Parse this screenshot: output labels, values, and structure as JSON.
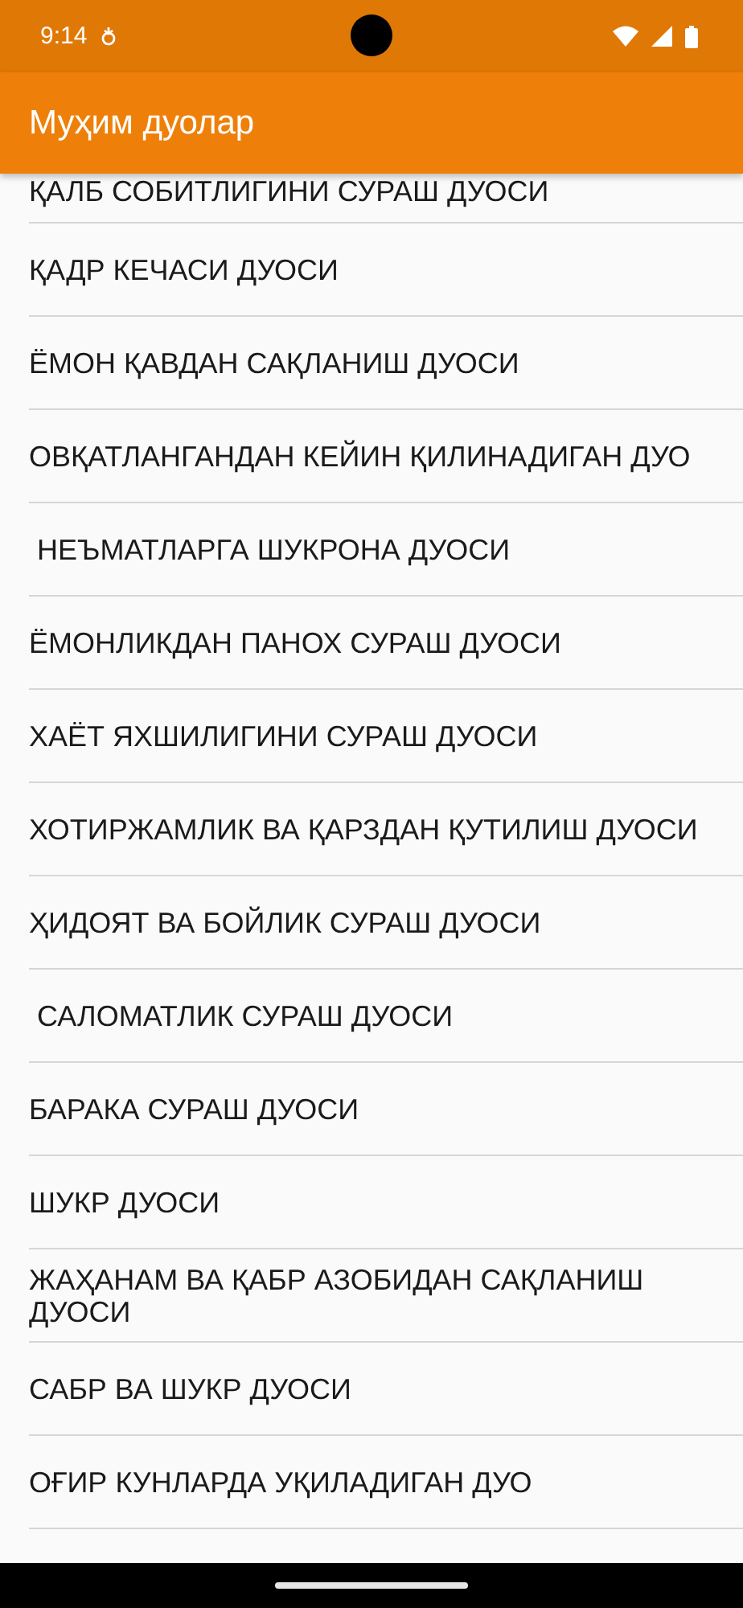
{
  "status_bar": {
    "time": "9:14"
  },
  "app_bar": {
    "title": "Муҳим дуолар"
  },
  "items": [
    {
      "label": "ҚАЛБ СОБИТЛИГИНИ СУРАШ ДУОСИ",
      "partial": true
    },
    {
      "label": "ҚАДР КЕЧАСИ ДУОСИ"
    },
    {
      "label": "ЁМОН ҚАВДАН САҚЛАНИШ ДУОСИ"
    },
    {
      "label": "ОВҚАТЛАНГАНДАН КЕЙИН ҚИЛИНАДИГАН ДУО"
    },
    {
      "label": " НЕЪМАТЛАРГА ШУКРОНА ДУОСИ"
    },
    {
      "label": "ЁМОНЛИКДАН ПАНОХ СУРАШ ДУОСИ"
    },
    {
      "label": "ХАЁТ ЯХШИЛИГИНИ СУРАШ ДУОСИ"
    },
    {
      "label": "ХОТИРЖАМЛИК ВА ҚАРЗДАН ҚУТИЛИШ ДУОСИ"
    },
    {
      "label": "ҲИДОЯТ ВА БОЙЛИК СУРАШ ДУОСИ"
    },
    {
      "label": " САЛОМАТЛИК СУРАШ ДУОСИ"
    },
    {
      "label": "БАРАКА СУРАШ ДУОСИ"
    },
    {
      "label": "ШУКР ДУОСИ"
    },
    {
      "label": "ЖАҲАНАМ ВА ҚАБР АЗОБИДАН САҚЛАНИШ ДУОСИ"
    },
    {
      "label": "САБР ВА ШУКР ДУОСИ"
    },
    {
      "label": "ОҒИР КУНЛАРДА УҚИЛАДИГАН ДУО"
    }
  ]
}
